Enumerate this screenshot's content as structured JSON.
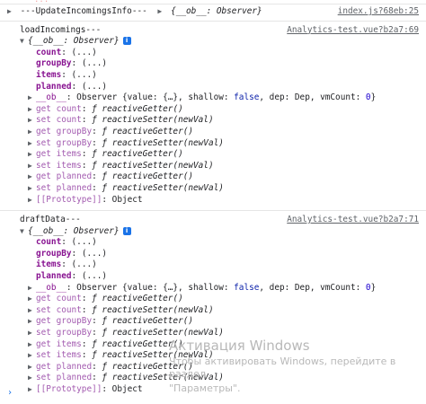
{
  "top_cut_text": "...",
  "messages": [
    {
      "header": "---UpdateIncomingsInfo---",
      "obj_summary": "{__ob__: Observer}",
      "source": "index.js?68eb:25",
      "collapsed": true
    },
    {
      "header": "loadIncomings---",
      "source": "Analytics-test.vue?b2a7:69",
      "obj_summary": "{__ob__: Observer}",
      "info_badge": "i",
      "props": [
        {
          "key": "count",
          "value": "(...)"
        },
        {
          "key": "groupBy",
          "value": "(...)"
        },
        {
          "key": "items",
          "value": "(...)"
        },
        {
          "key": "planned",
          "value": "(...)"
        }
      ],
      "ob_line": {
        "key": "__ob__",
        "text_pre": "Observer {value: {…}, shallow: ",
        "bool": "false",
        "text_mid": ", dep: Dep, vmCount: ",
        "num": "0",
        "text_end": "}"
      },
      "accessors": [
        {
          "label": "get count",
          "fn": "reactiveGetter()"
        },
        {
          "label": "set count",
          "fn": "reactiveSetter(newVal)"
        },
        {
          "label": "get groupBy",
          "fn": "reactiveGetter()"
        },
        {
          "label": "set groupBy",
          "fn": "reactiveSetter(newVal)"
        },
        {
          "label": "get items",
          "fn": "reactiveGetter()"
        },
        {
          "label": "set items",
          "fn": "reactiveSetter(newVal)"
        },
        {
          "label": "get planned",
          "fn": "reactiveGetter()"
        },
        {
          "label": "set planned",
          "fn": "reactiveSetter(newVal)"
        }
      ],
      "prototype": {
        "key": "[[Prototype]]",
        "value": "Object"
      }
    },
    {
      "header": "draftData---",
      "source": "Analytics-test.vue?b2a7:71",
      "obj_summary": "{__ob__: Observer}",
      "info_badge": "i",
      "props": [
        {
          "key": "count",
          "value": "(...)"
        },
        {
          "key": "groupBy",
          "value": "(...)"
        },
        {
          "key": "items",
          "value": "(...)"
        },
        {
          "key": "planned",
          "value": "(...)"
        }
      ],
      "ob_line": {
        "key": "__ob__",
        "text_pre": "Observer {value: {…}, shallow: ",
        "bool": "false",
        "text_mid": ", dep: Dep, vmCount: ",
        "num": "0",
        "text_end": "}"
      },
      "accessors": [
        {
          "label": "get count",
          "fn": "reactiveGetter()"
        },
        {
          "label": "set count",
          "fn": "reactiveSetter(newVal)"
        },
        {
          "label": "get groupBy",
          "fn": "reactiveGetter()"
        },
        {
          "label": "set groupBy",
          "fn": "reactiveSetter(newVal)"
        },
        {
          "label": "get items",
          "fn": "reactiveGetter()"
        },
        {
          "label": "set items",
          "fn": "reactiveSetter(newVal)"
        },
        {
          "label": "get planned",
          "fn": "reactiveGetter()"
        },
        {
          "label": "set planned",
          "fn": "reactiveSetter(newVal)"
        }
      ],
      "prototype": {
        "key": "[[Prototype]]",
        "value": "Object"
      }
    }
  ],
  "prompt_symbol": "›",
  "watermark": {
    "line1": "Активация Windows",
    "line2": "Чтобы активировать Windows, перейдите в раздел",
    "line3": "\"Параметры\"."
  },
  "f_symbol": "ƒ",
  "colors": {
    "key": "#881391",
    "bool": "#0d22aa",
    "num": "#1c00cf",
    "badge": "#1a73e8"
  }
}
